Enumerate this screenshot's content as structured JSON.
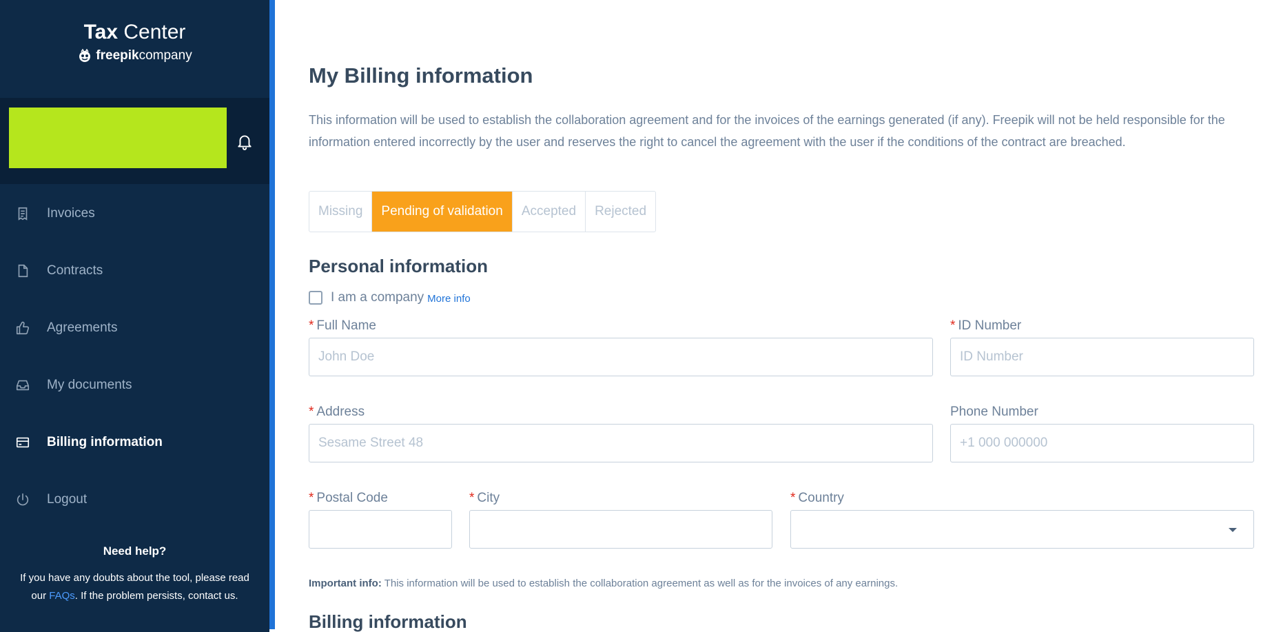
{
  "brand": {
    "title_bold": "Tax",
    "title_rest": "Center",
    "sub_bold": "freepik",
    "sub_rest": "company"
  },
  "sidebar": {
    "items": [
      {
        "label": "Invoices",
        "icon": "receipt-icon"
      },
      {
        "label": "Contracts",
        "icon": "file-icon"
      },
      {
        "label": "Agreements",
        "icon": "thumbs-up-icon"
      },
      {
        "label": "My documents",
        "icon": "inbox-icon"
      },
      {
        "label": "Billing information",
        "icon": "credit-card-icon",
        "active": true
      },
      {
        "label": "Logout",
        "icon": "power-icon"
      }
    ],
    "help": {
      "title": "Need help?",
      "text_before": "If you have any doubts about the tool, please read our ",
      "link": "FAQs",
      "text_after": ". If the problem persists, contact us."
    }
  },
  "main": {
    "title": "My Billing information",
    "intro": "This information will be used to establish the collaboration agreement and for the invoices of the earnings generated (if any). Freepik will not be held responsible for the information entered incorrectly by the user and reserves the right to cancel the agreement with the user if the conditions of the contract are breached.",
    "status_tabs": [
      {
        "label": "Missing"
      },
      {
        "label": "Pending of validation",
        "active": true
      },
      {
        "label": "Accepted"
      },
      {
        "label": "Rejected"
      }
    ],
    "personal_title": "Personal information",
    "company_checkbox_label": "I am a company",
    "more_info": "More info",
    "required_mark": "*",
    "fields": {
      "full_name": {
        "label": "Full Name",
        "placeholder": "John Doe",
        "value": ""
      },
      "id_number": {
        "label": "ID Number",
        "placeholder": "ID Number",
        "value": ""
      },
      "address": {
        "label": "Address",
        "placeholder": "Sesame Street 48",
        "value": ""
      },
      "phone": {
        "label": "Phone Number",
        "placeholder": "+1 000 000000",
        "value": ""
      },
      "postal_code": {
        "label": "Postal Code",
        "placeholder": "",
        "value": ""
      },
      "city": {
        "label": "City",
        "placeholder": "",
        "value": ""
      },
      "country": {
        "label": "Country",
        "value": ""
      }
    },
    "important_label": "Important info:",
    "important_text": " This information will be used to establish the collaboration agreement as well as for the invoices of any earnings.",
    "billing_title": "Billing information"
  },
  "colors": {
    "sidebar_bg": "#0e2a47",
    "accent": "#1f73d8",
    "active_tab": "#f9a11b",
    "avatar": "#b5e61d",
    "required": "#e0281b"
  }
}
